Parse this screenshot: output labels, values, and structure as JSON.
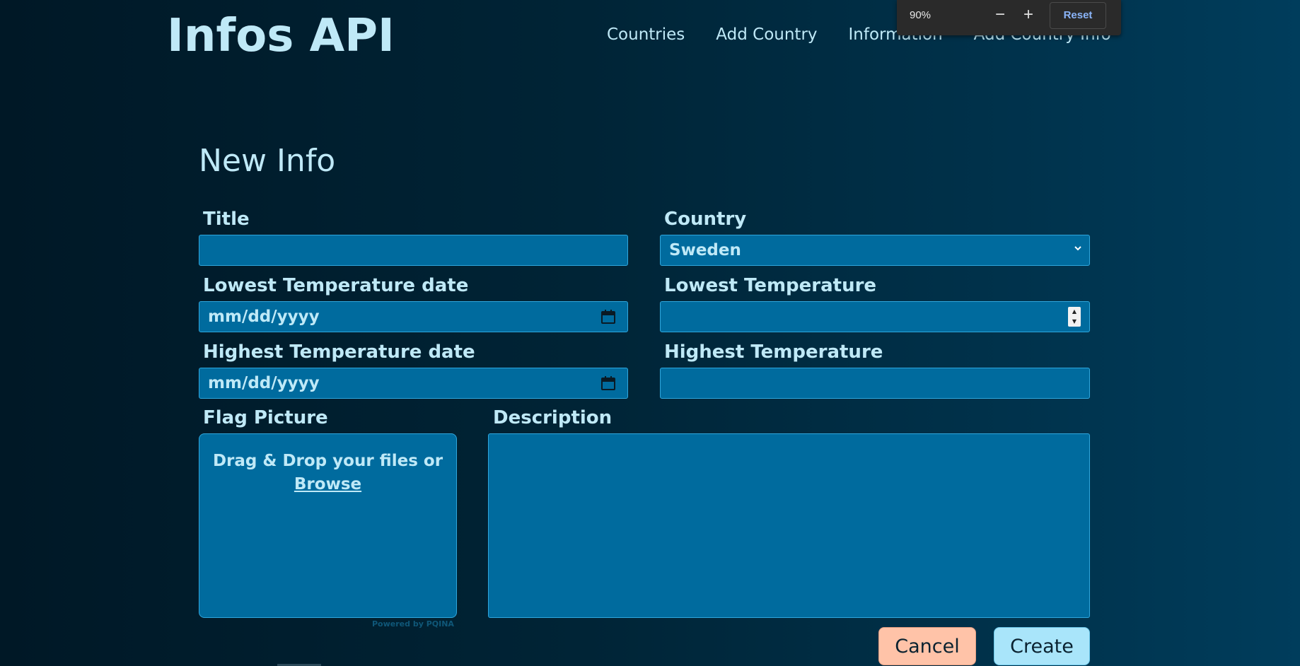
{
  "header": {
    "logo": "Infos API",
    "nav": [
      {
        "label": "Countries"
      },
      {
        "label": "Add Country"
      },
      {
        "label": "Information"
      },
      {
        "label": "Add Country Info"
      }
    ]
  },
  "zoom_popup": {
    "level": "90%",
    "minus": "−",
    "plus": "+",
    "reset": "Reset"
  },
  "form": {
    "title": "New Info",
    "fields": {
      "title": {
        "label": "Title",
        "value": ""
      },
      "country": {
        "label": "Country",
        "value": "Sweden"
      },
      "lowest_temp_date": {
        "label": "Lowest Temperature date",
        "placeholder": "mm/dd/yyyy"
      },
      "lowest_temp": {
        "label": "Lowest Temperature",
        "value": ""
      },
      "highest_temp_date": {
        "label": "Highest Temperature date",
        "placeholder": "mm/dd/yyyy"
      },
      "highest_temp": {
        "label": "Highest Temperature",
        "value": ""
      },
      "flag_picture": {
        "label": "Flag Picture",
        "drop_text": "Drag & Drop your files or",
        "browse": "Browse",
        "powered_by": "Powered by PQINA"
      },
      "description": {
        "label": "Description",
        "value": ""
      }
    },
    "buttons": {
      "cancel": "Cancel",
      "create": "Create"
    }
  },
  "colors": {
    "field_bg": "#006b9e",
    "field_border": "#2fa6dc",
    "text": "#bfe9f7",
    "cancel_bg": "#ffc3a8",
    "create_bg": "#a9e5fa"
  }
}
